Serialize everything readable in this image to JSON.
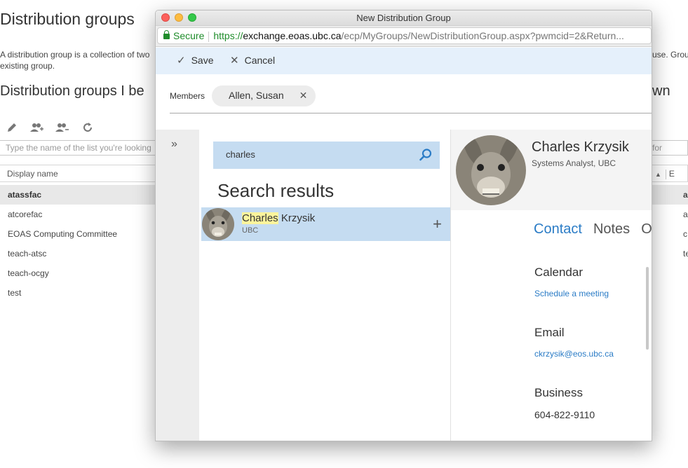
{
  "background": {
    "title": "Distribution groups",
    "desc_line1_left": "A distribution group is a collection of two",
    "desc_line1_right": "use. Group",
    "desc_line2": "existing group.",
    "section_title_left": "Distribution groups I be",
    "section_title_right": "wn",
    "search_placeholder_left": "Type the name of the list you're looking",
    "search_placeholder_right": "for",
    "column_header": "Display name",
    "column_header_right": "E",
    "rows": [
      "atassfac",
      "atcorefac",
      "EOAS Computing Committee",
      "teach-atsc",
      "teach-ocgy",
      "test"
    ],
    "rows_right": [
      "a",
      "a",
      "c",
      "te"
    ]
  },
  "window": {
    "title": "New Distribution Group",
    "url": {
      "secure_label": "Secure",
      "protocol": "https://",
      "host": "exchange.eoas.ubc.ca",
      "path": "/ecp/MyGroups/NewDistributionGroup.aspx?pwmcid=2&Return..."
    },
    "actions": {
      "save_label": "Save",
      "cancel_label": "Cancel"
    },
    "members": {
      "label": "Members",
      "chip": "Allen, Susan"
    },
    "search": {
      "query": "charles",
      "results_title": "Search results",
      "result_highlight": "Charles",
      "result_rest": " Krzysik",
      "result_sub": "UBC"
    },
    "detail": {
      "name": "Charles Krzysik",
      "job_title": "Systems Analyst, UBC",
      "tabs": [
        "Contact",
        "Notes",
        "O"
      ],
      "calendar_heading": "Calendar",
      "calendar_link": "Schedule a meeting",
      "email_heading": "Email",
      "email_value": "ckrzysik@eos.ubc.ca",
      "business_heading": "Business",
      "business_value": "604-822-9110"
    }
  },
  "colors": {
    "accent": "#2b7cc6",
    "selection": "#c5dcf1",
    "highlight": "#fbf49c",
    "secure_green": "#1e8c2a"
  }
}
